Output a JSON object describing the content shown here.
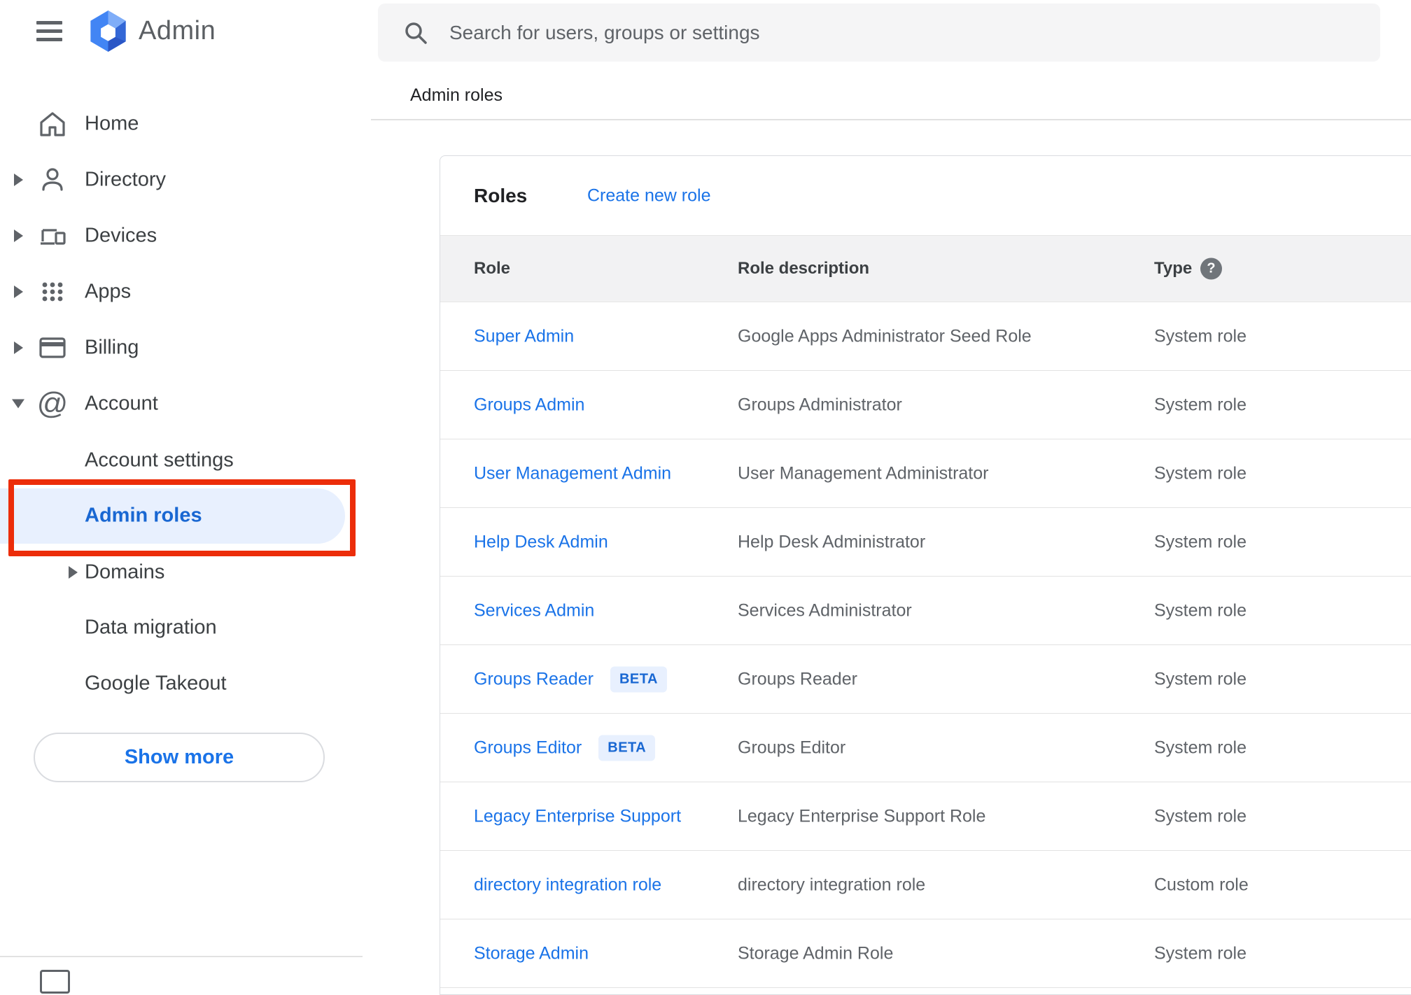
{
  "app": {
    "logo_text": "Admin",
    "search_placeholder": "Search for users, groups or settings"
  },
  "sidebar": {
    "items": [
      {
        "label": "Home"
      },
      {
        "label": "Directory"
      },
      {
        "label": "Devices"
      },
      {
        "label": "Apps"
      },
      {
        "label": "Billing"
      },
      {
        "label": "Account",
        "expanded": true
      },
      {
        "label": "Account settings"
      },
      {
        "label": "Admin roles",
        "selected": true
      },
      {
        "label": "Domains"
      },
      {
        "label": "Data migration"
      },
      {
        "label": "Google Takeout"
      }
    ],
    "show_more_label": "Show more"
  },
  "breadcrumb": "Admin roles",
  "roles_card": {
    "title": "Roles",
    "create_link": "Create new role",
    "columns": {
      "role": "Role",
      "description": "Role description",
      "type": "Type"
    },
    "help_icon_glyph": "?",
    "rows": [
      {
        "role": "Super Admin",
        "description": "Google Apps Administrator Seed Role",
        "type": "System role"
      },
      {
        "role": "Groups Admin",
        "description": "Groups Administrator",
        "type": "System role"
      },
      {
        "role": "User Management Admin",
        "description": "User Management Administrator",
        "type": "System role"
      },
      {
        "role": "Help Desk Admin",
        "description": "Help Desk Administrator",
        "type": "System role"
      },
      {
        "role": "Services Admin",
        "description": "Services Administrator",
        "type": "System role"
      },
      {
        "role": "Groups Reader",
        "badge": "BETA",
        "description": "Groups Reader",
        "type": "System role"
      },
      {
        "role": "Groups Editor",
        "badge": "BETA",
        "description": "Groups Editor",
        "type": "System role"
      },
      {
        "role": "Legacy Enterprise Support",
        "description": "Legacy Enterprise Support Role",
        "type": "System role"
      },
      {
        "role": "directory integration role",
        "description": "directory integration role",
        "type": "Custom role"
      },
      {
        "role": "Storage Admin",
        "description": "Storage Admin Role",
        "type": "System role"
      }
    ]
  },
  "colors": {
    "link_blue": "#1a73e8",
    "selected_text_blue": "#1967d2",
    "selected_item_bg": "#e8f0fe",
    "beta_badge_bg": "#e8f0fe",
    "beta_badge_text": "#1967d2",
    "annotation_red": "#ec2d0a",
    "search_bg": "#f5f5f6",
    "table_header_bg": "#f2f2f3",
    "icon_gray": "#5f6368"
  }
}
